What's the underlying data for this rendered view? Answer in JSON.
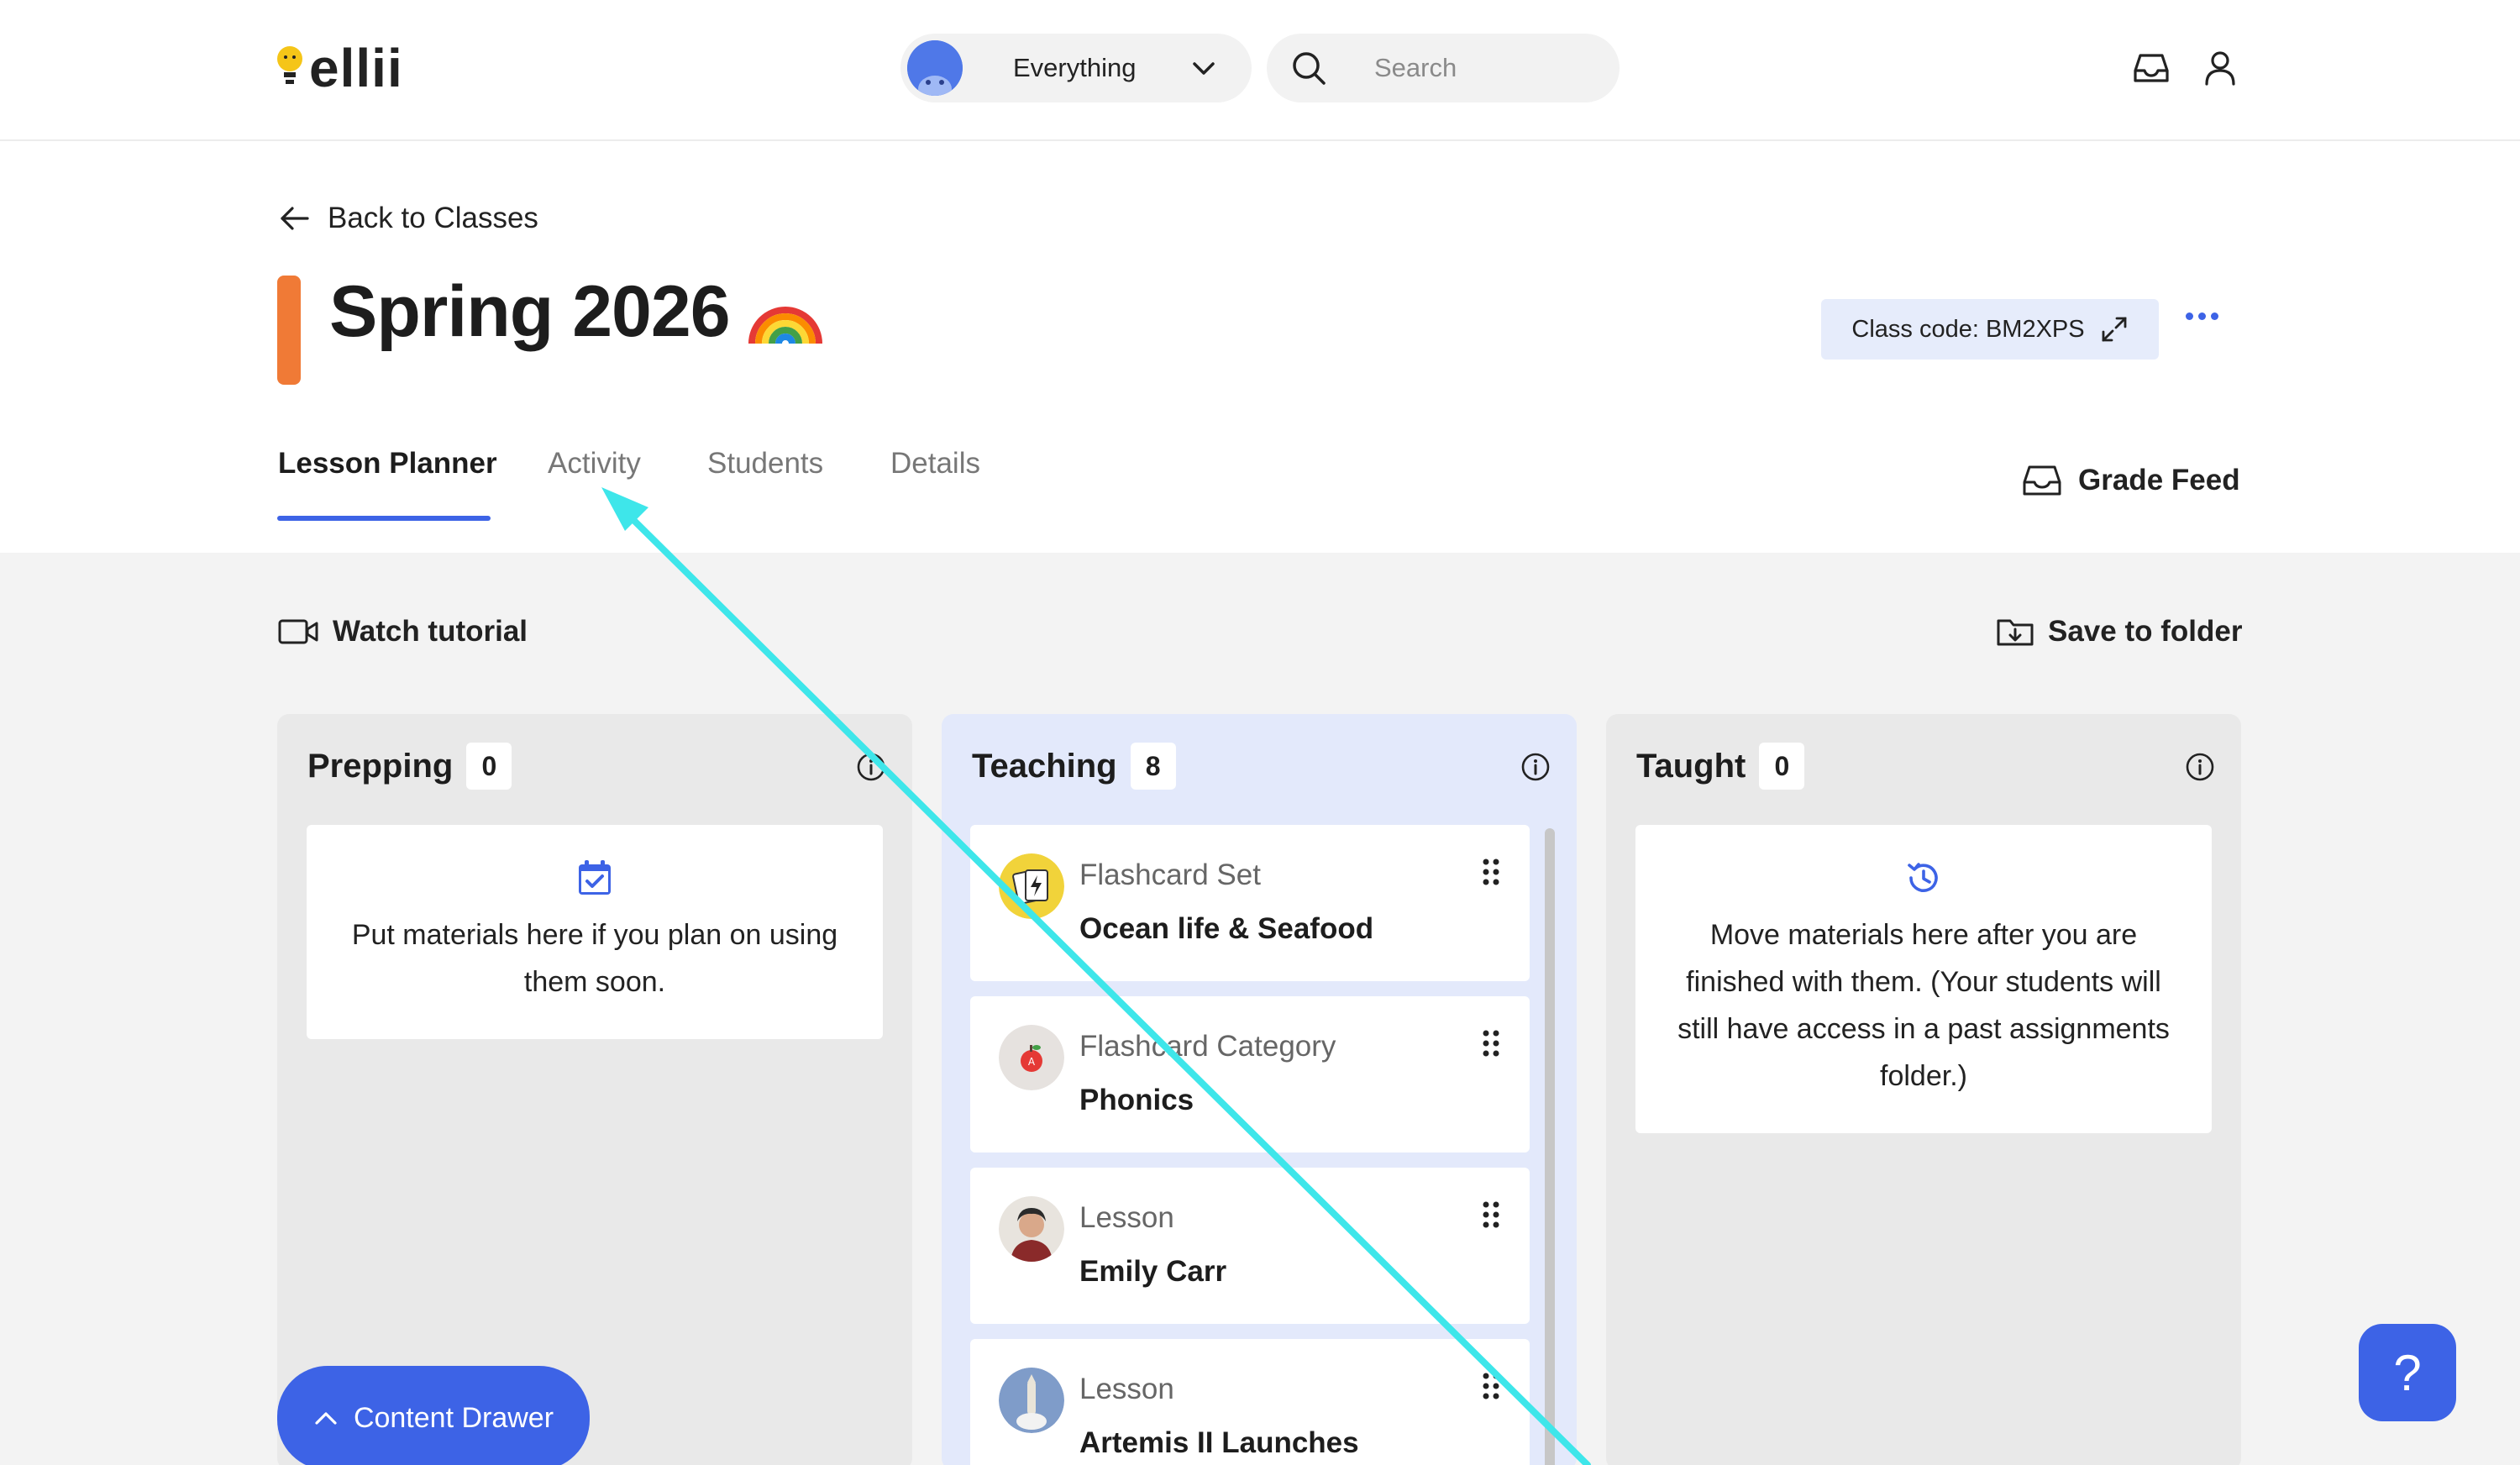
{
  "brand": {
    "name": "ellii"
  },
  "header": {
    "scope_label": "Everything",
    "search_placeholder": "Search"
  },
  "nav": {
    "back_label": "Back to Classes"
  },
  "class": {
    "title": "Spring 2026",
    "emoji": "🌈",
    "class_code": "Class code: BM2XPS",
    "accent_color": "#f07a36"
  },
  "tabs": [
    {
      "label": "Lesson Planner",
      "active": true
    },
    {
      "label": "Activity",
      "active": false
    },
    {
      "label": "Students",
      "active": false
    },
    {
      "label": "Details",
      "active": false
    }
  ],
  "actions": {
    "grade_feed": "Grade Feed",
    "watch_tutorial": "Watch tutorial",
    "save_to_folder": "Save to folder",
    "content_drawer": "Content Drawer",
    "help": "?"
  },
  "columns": {
    "prepping": {
      "name": "Prepping",
      "count": "0",
      "empty_text": "Put materials here if you plan on using them soon."
    },
    "teaching": {
      "name": "Teaching",
      "count": "8",
      "items": [
        {
          "kind": "Flashcard Set",
          "title": "Ocean life & Seafood"
        },
        {
          "kind": "Flashcard Category",
          "title": "Phonics"
        },
        {
          "kind": "Lesson",
          "title": "Emily Carr"
        },
        {
          "kind": "Lesson",
          "title": "Artemis II Launches"
        }
      ]
    },
    "taught": {
      "name": "Taught",
      "count": "0",
      "empty_text": "Move materials here after you are finished with them. (Your students will still have access in a past assignments folder.)"
    }
  },
  "colors": {
    "primary": "#3d63e6",
    "annotation_arrow": "#3ee6ea"
  }
}
